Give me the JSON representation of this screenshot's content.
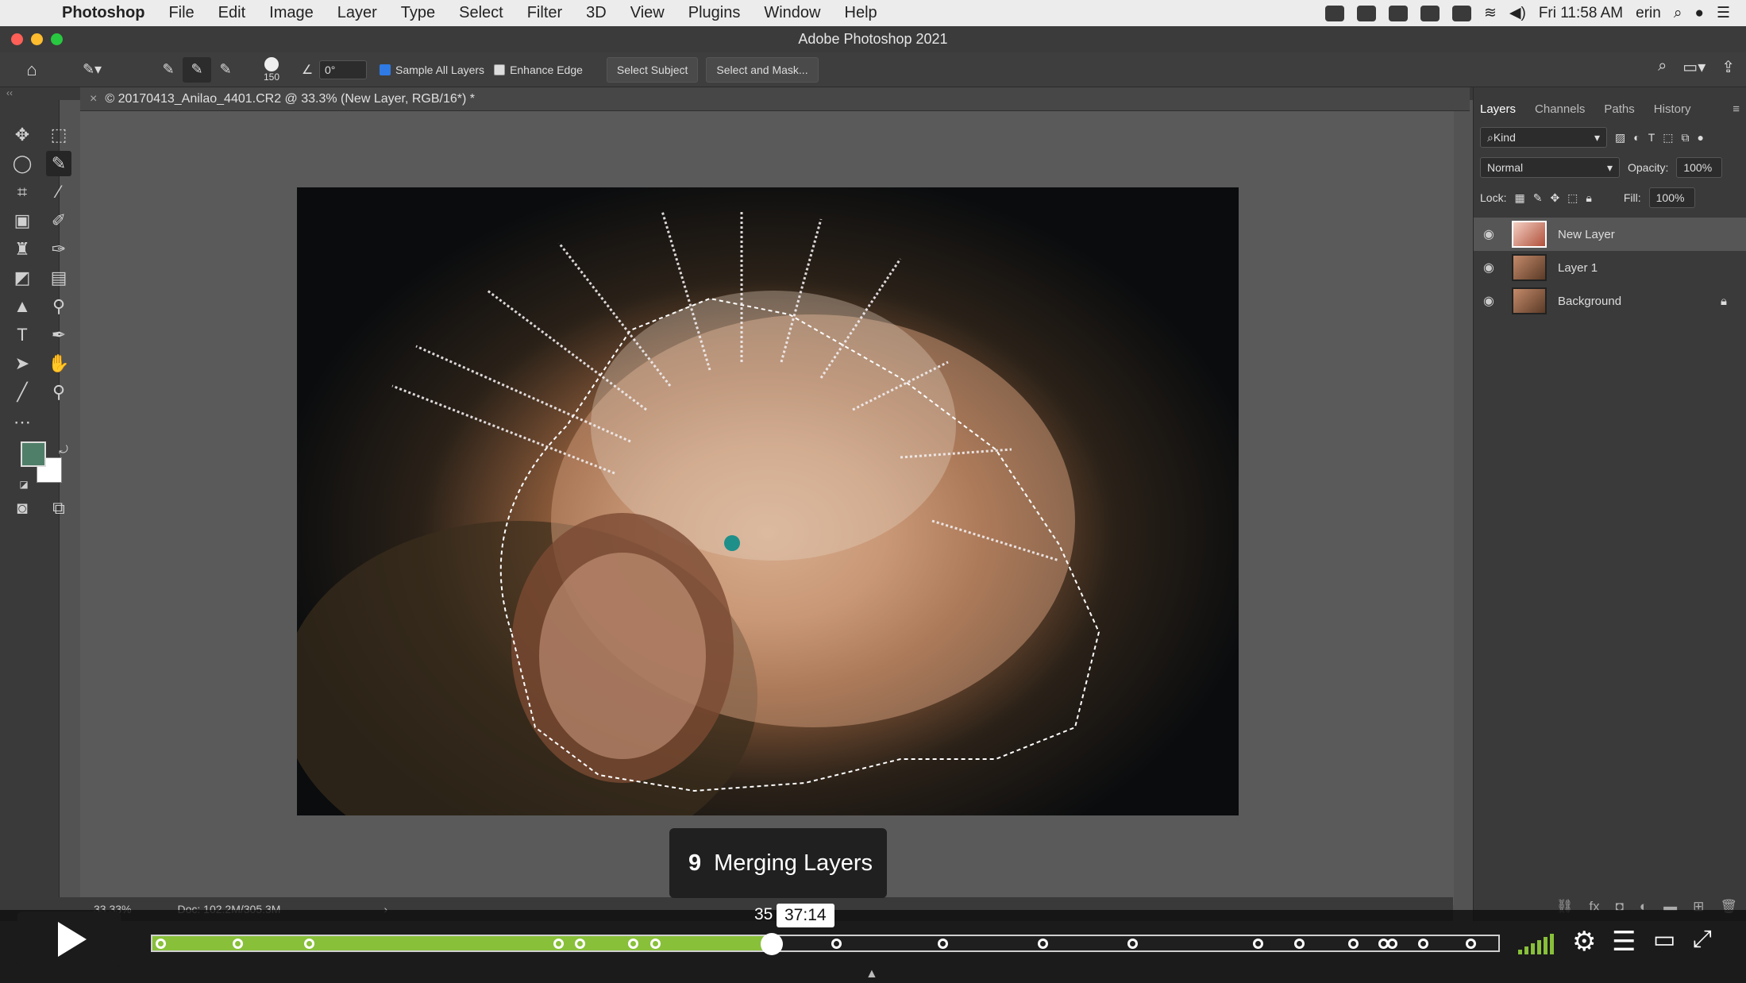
{
  "menubar": {
    "app": "Photoshop",
    "items": [
      "File",
      "Edit",
      "Image",
      "Layer",
      "Type",
      "Select",
      "Filter",
      "3D",
      "View",
      "Plugins",
      "Window",
      "Help"
    ],
    "clock": "Fri 11:58 AM",
    "user": "erin"
  },
  "window": {
    "title": "Adobe Photoshop 2021"
  },
  "options": {
    "brush_size": "150",
    "angle": "0°",
    "sample_all_layers": "Sample All Layers",
    "enhance_edge": "Enhance Edge",
    "select_subject": "Select Subject",
    "select_and_mask": "Select and Mask..."
  },
  "document": {
    "tab_title": "© 20170413_Anilao_4401.CR2 @ 33.3% (New Layer, RGB/16*) *",
    "zoom": "33.33%",
    "doc_info": "Doc: 102.2M/305.3M"
  },
  "panels": {
    "tabs": [
      "Layers",
      "Channels",
      "Paths",
      "History"
    ],
    "filter_kind": "Kind",
    "blend_mode": "Normal",
    "opacity_label": "Opacity:",
    "opacity": "100%",
    "lock_label": "Lock:",
    "fill_label": "Fill:",
    "fill": "100%",
    "layers": [
      {
        "name": "New Layer"
      },
      {
        "name": "Layer 1"
      },
      {
        "name": "Background"
      }
    ]
  },
  "player": {
    "chapter_number": "9",
    "chapter_title": "Merging Layers",
    "hover_chapter": "35",
    "hover_time": "37:14",
    "progress": 0.46,
    "chapter_markers": [
      0.005,
      0.062,
      0.115,
      0.3,
      0.316,
      0.356,
      0.372,
      0.46,
      0.507,
      0.586,
      0.66,
      0.727,
      0.82,
      0.851,
      0.891,
      0.913,
      0.92,
      0.943,
      0.978
    ]
  }
}
